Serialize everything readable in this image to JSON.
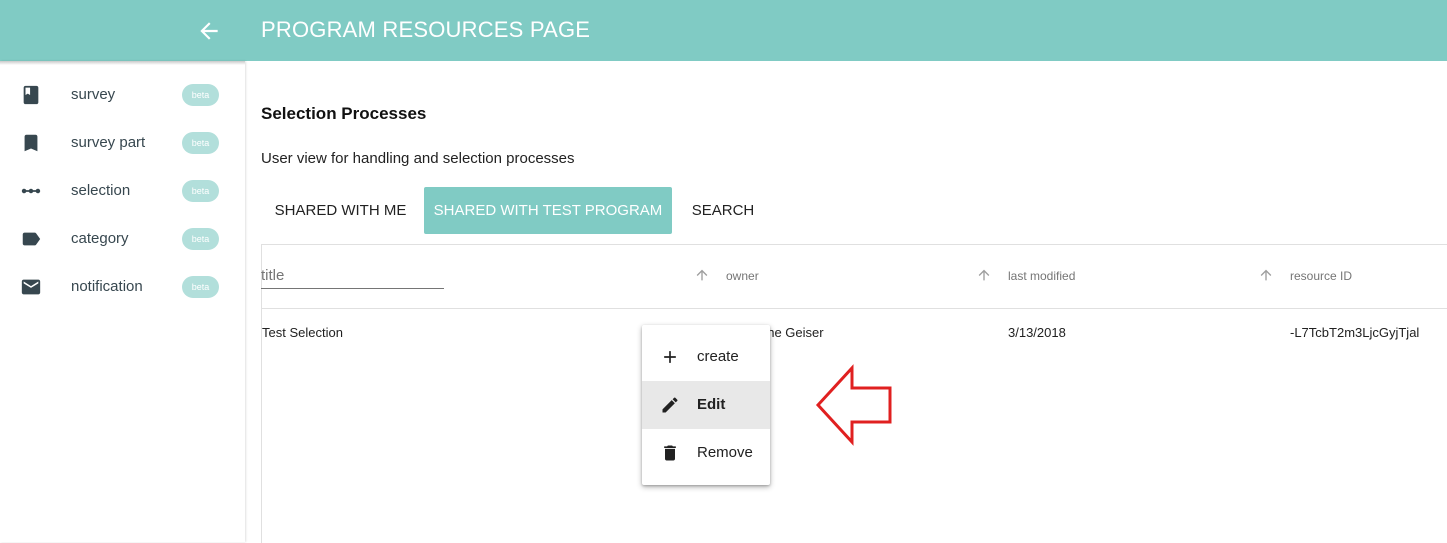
{
  "header": {
    "title": "PROGRAM RESOURCES PAGE",
    "back_icon": "arrow-back-icon"
  },
  "sidebar": {
    "items": [
      {
        "label": "survey",
        "icon": "book-icon",
        "badge": "beta"
      },
      {
        "label": "survey part",
        "icon": "bookmark-icon",
        "badge": "beta"
      },
      {
        "label": "selection",
        "icon": "linear-scale-icon",
        "badge": "beta"
      },
      {
        "label": "category",
        "icon": "label-icon",
        "badge": "beta"
      },
      {
        "label": "notification",
        "icon": "mail-icon",
        "badge": "beta"
      }
    ]
  },
  "main": {
    "title": "Selection Processes",
    "description": "User view for handling and selection processes",
    "tabs": [
      {
        "label": "SHARED WITH ME",
        "active": false
      },
      {
        "label": "SHARED WITH  TEST PROGRAM",
        "active": true
      },
      {
        "label": "SEARCH",
        "active": false
      }
    ]
  },
  "table": {
    "filter": {
      "placeholder": "title",
      "value": ""
    },
    "columns": [
      "owner",
      "last modified",
      "resource ID"
    ],
    "rows": [
      {
        "title": "Test Selection",
        "owner": "phe Geiser",
        "last_modified": "3/13/2018",
        "resource_id": "-L7TcbT2m3LjcGyjTjal"
      }
    ]
  },
  "context_menu": {
    "items": [
      {
        "label": "create",
        "icon": "add-icon",
        "highlighted": false
      },
      {
        "label": "Edit",
        "icon": "edit-icon",
        "highlighted": true
      },
      {
        "label": "Remove",
        "icon": "delete-icon",
        "highlighted": false
      }
    ]
  },
  "colors": {
    "primary": "#80cbc4",
    "badge": "#b2dfdb",
    "annotation": "#e02020"
  }
}
